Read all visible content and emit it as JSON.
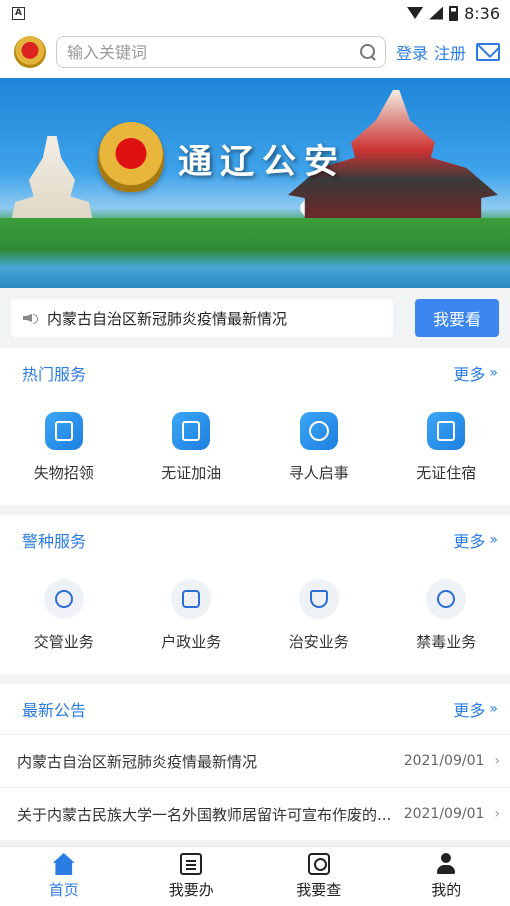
{
  "status_bar": {
    "time": "8:36",
    "app_indicator": "A"
  },
  "header": {
    "search_placeholder": "输入关键词",
    "login_label": "登录",
    "register_label": "注册"
  },
  "banner": {
    "title": "通辽公安"
  },
  "notice": {
    "text": "内蒙古自治区新冠肺炎疫情最新情况",
    "button_label": "我要看"
  },
  "hot_services": {
    "title": "热门服务",
    "more_label": "更多",
    "items": [
      {
        "label": "失物招领",
        "icon": "lost-found-icon"
      },
      {
        "label": "无证加油",
        "icon": "fuel-icon"
      },
      {
        "label": "寻人启事",
        "icon": "missing-person-icon"
      },
      {
        "label": "无证住宿",
        "icon": "hotel-icon"
      }
    ]
  },
  "police_services": {
    "title": "警种服务",
    "more_label": "更多",
    "items": [
      {
        "label": "交管业务",
        "icon": "traffic-police-icon"
      },
      {
        "label": "户政业务",
        "icon": "household-icon"
      },
      {
        "label": "治安业务",
        "icon": "security-shield-icon"
      },
      {
        "label": "禁毒业务",
        "icon": "anti-drug-icon"
      }
    ]
  },
  "announcements": {
    "title": "最新公告",
    "more_label": "更多",
    "items": [
      {
        "title": "内蒙古自治区新冠肺炎疫情最新情况",
        "date": "2021/09/01"
      },
      {
        "title": "关于内蒙古民族大学一名外国教师居留许可宣布作废的...",
        "date": "2021/09/01"
      }
    ]
  },
  "bottom_nav": {
    "items": [
      {
        "label": "首页",
        "active": true
      },
      {
        "label": "我要办",
        "active": false
      },
      {
        "label": "我要查",
        "active": false
      },
      {
        "label": "我的",
        "active": false
      }
    ]
  },
  "colors": {
    "accent": "#2b7ce3",
    "button": "#3b86f0"
  }
}
